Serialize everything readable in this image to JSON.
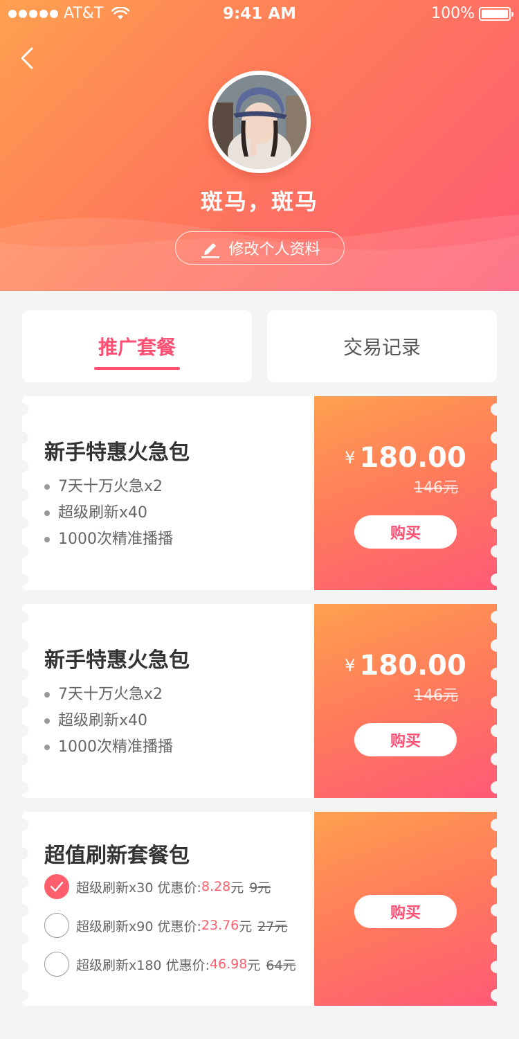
{
  "status_bar": {
    "carrier": "AT&T",
    "time": "9:41 AM",
    "battery": "100%"
  },
  "profile": {
    "name": "斑马，斑马",
    "edit_label": "修改个人资料"
  },
  "tabs": [
    {
      "label": "推广套餐",
      "active": true
    },
    {
      "label": "交易记录",
      "active": false
    }
  ],
  "packages": [
    {
      "title": "新手特惠火急包",
      "features": [
        "7天十万火急x2",
        "超级刷新x40",
        "1000次精准播播"
      ],
      "currency": "¥",
      "price": "180.00",
      "original_price": "146元",
      "buy_label": "购买"
    },
    {
      "title": "新手特惠火急包",
      "features": [
        "7天十万火急x2",
        "超级刷新x40",
        "1000次精准播播"
      ],
      "currency": "¥",
      "price": "180.00",
      "original_price": "146元",
      "buy_label": "购买"
    },
    {
      "title": "超值刷新套餐包",
      "buy_label": "购买",
      "options": [
        {
          "name": "超级刷新x30",
          "discount_label": "优惠价:",
          "discount_price": "8.28",
          "unit": "元",
          "original": "9元",
          "checked": true
        },
        {
          "name": "超级刷新x90",
          "discount_label": "优惠价:",
          "discount_price": "23.76",
          "unit": "元",
          "original": "27元",
          "checked": false
        },
        {
          "name": "超级刷新x180",
          "discount_label": "优惠价:",
          "discount_price": "46.98",
          "unit": "元",
          "original": "64元",
          "checked": false
        }
      ]
    }
  ],
  "colors": {
    "accent": "#ff4f73",
    "header_start": "#ffa04f",
    "header_end": "#ff5a76",
    "background": "#f4f4f4"
  }
}
